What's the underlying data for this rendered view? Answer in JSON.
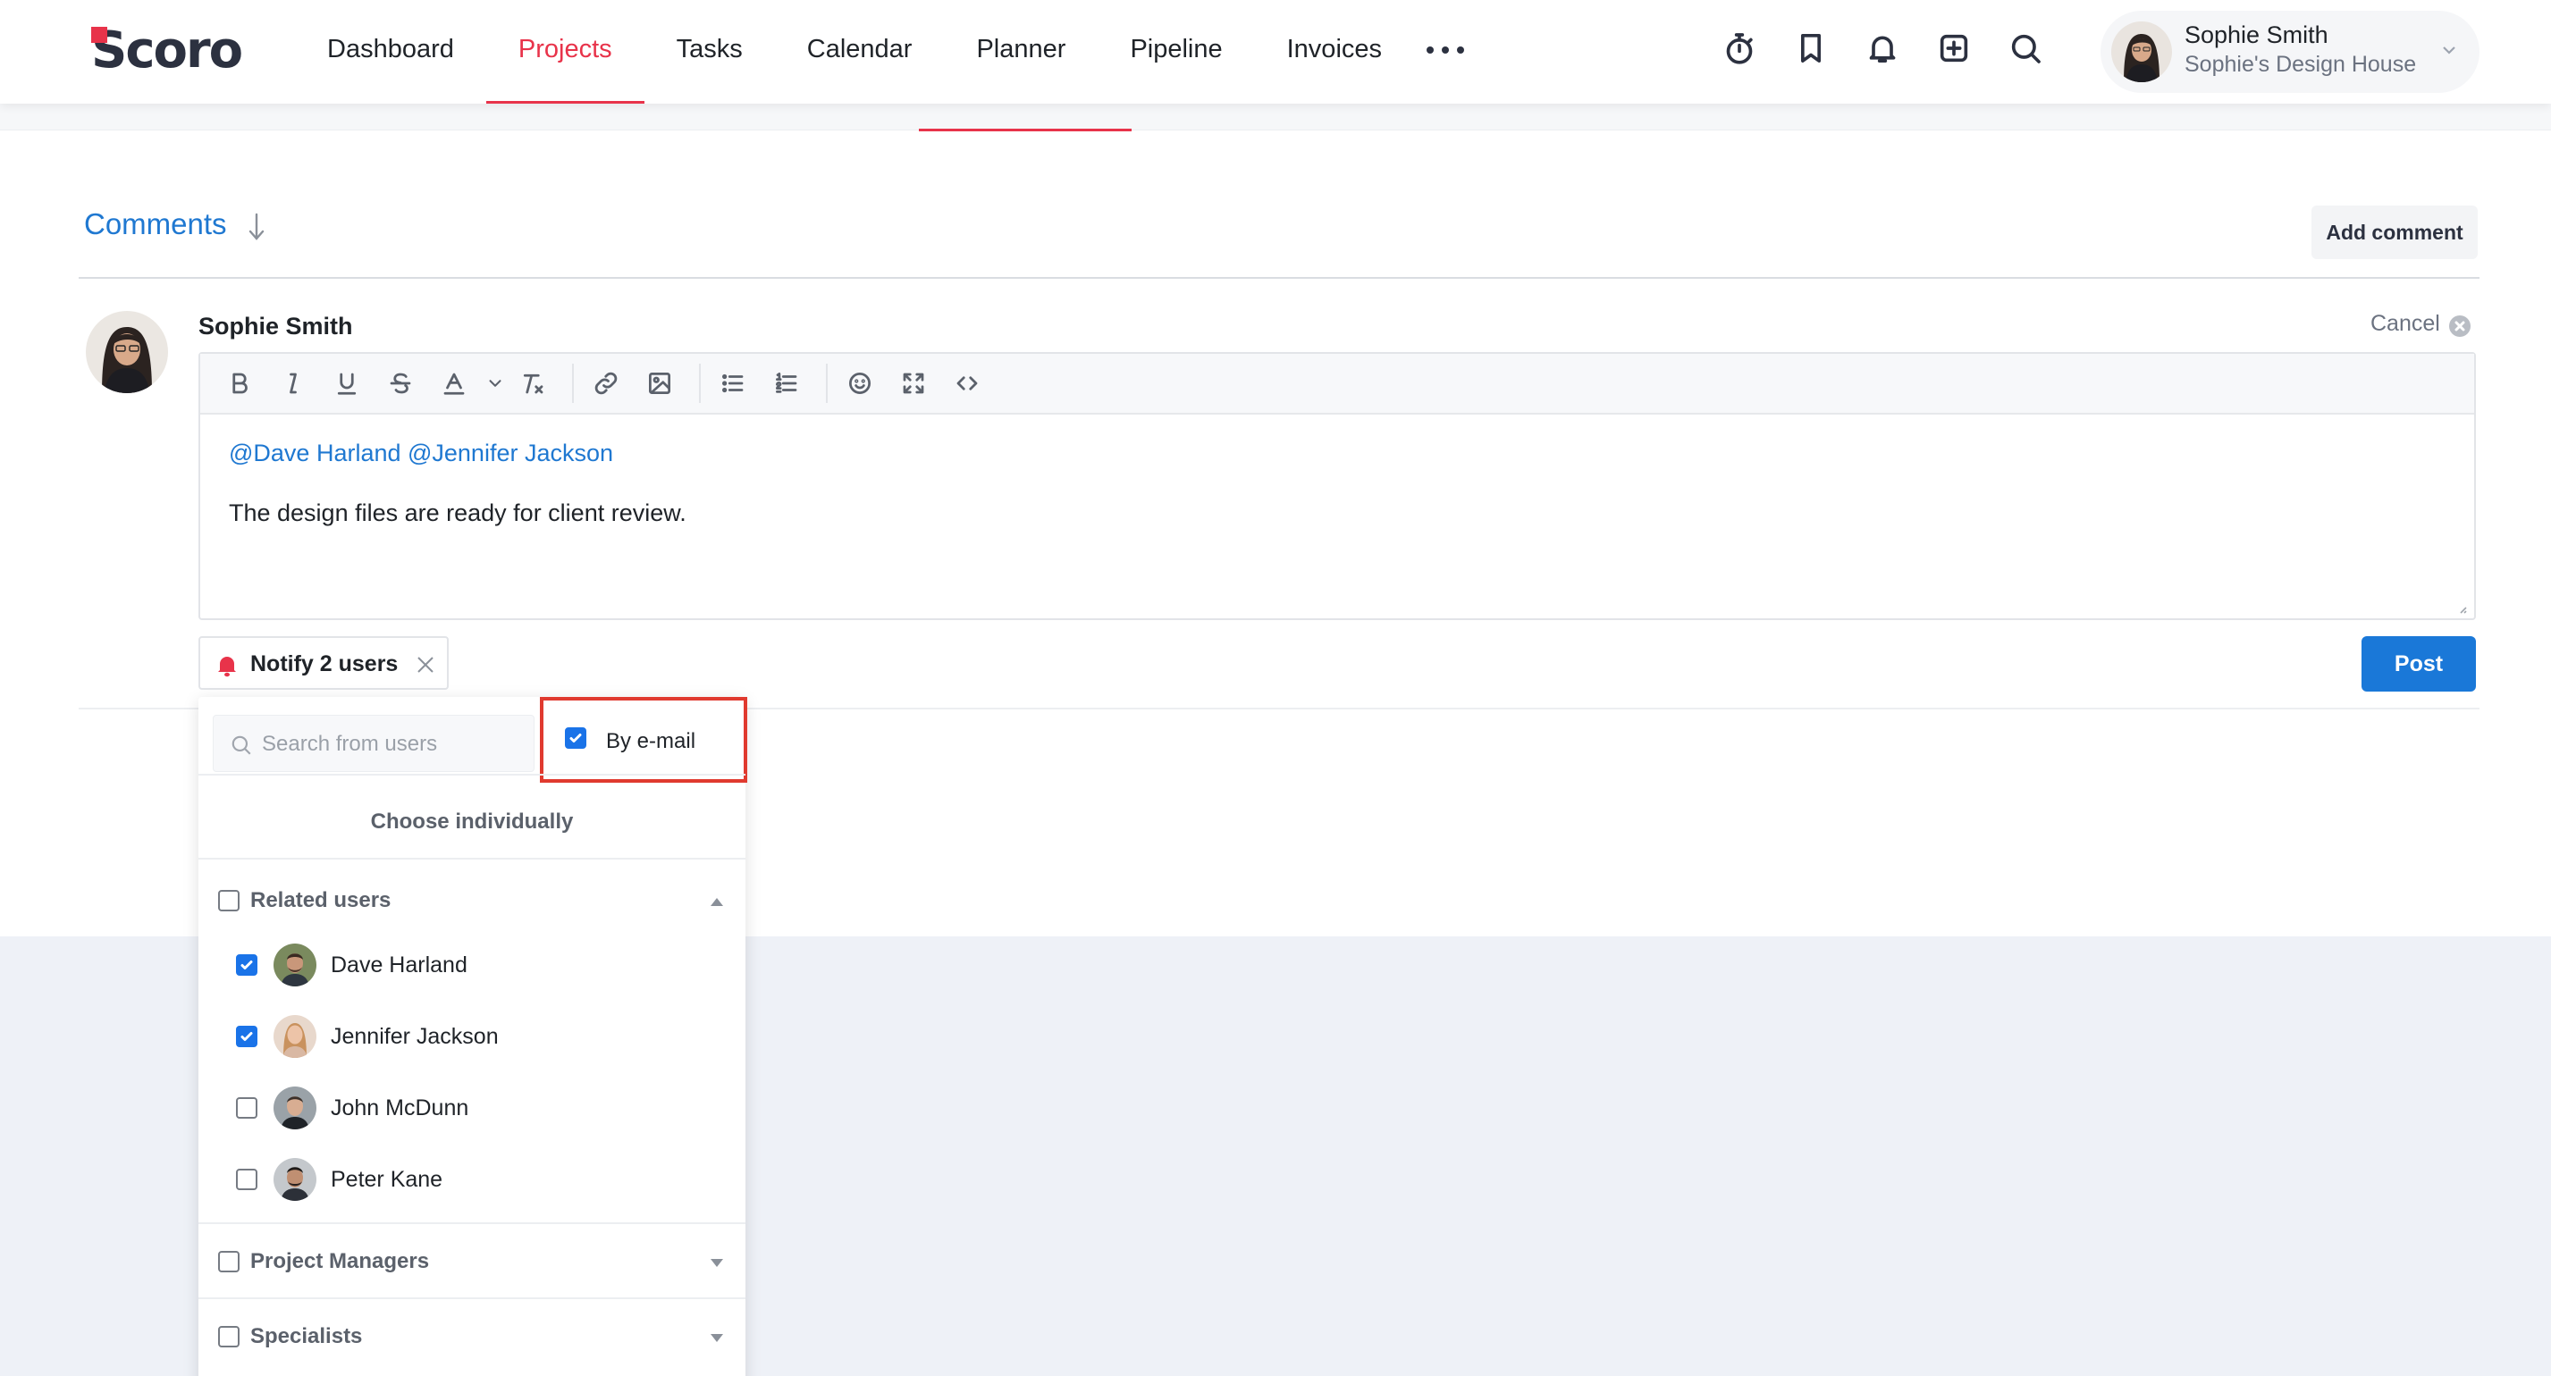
{
  "app": {
    "logo_text": "Scoro"
  },
  "nav": {
    "items": [
      {
        "label": "Dashboard",
        "active": false
      },
      {
        "label": "Projects",
        "active": true
      },
      {
        "label": "Tasks",
        "active": false
      },
      {
        "label": "Calendar",
        "active": false
      },
      {
        "label": "Planner",
        "active": false
      },
      {
        "label": "Pipeline",
        "active": false
      },
      {
        "label": "Invoices",
        "active": false
      }
    ],
    "more_icon": "more-dots-icon"
  },
  "toolbar_icons": [
    "timer-icon",
    "bookmark-icon",
    "bell-icon",
    "add-square-icon",
    "search-icon"
  ],
  "user": {
    "name": "Sophie Smith",
    "company": "Sophie's Design House"
  },
  "comments": {
    "title": "Comments",
    "add_label": "Add comment"
  },
  "editor": {
    "author": "Sophie Smith",
    "cancel_label": "Cancel",
    "mentions": "@Dave Harland @Jennifer Jackson",
    "text": "The design files are ready for client review.",
    "formatting": [
      "bold",
      "italic",
      "underline",
      "strikethrough",
      "font-color",
      "clear-format",
      "link",
      "image",
      "bullet-list",
      "numbered-list",
      "emoji",
      "fullscreen",
      "code"
    ]
  },
  "notify": {
    "label": "Notify 2 users",
    "post_label": "Post"
  },
  "dropdown": {
    "search_placeholder": "Search from users",
    "email_label": "By e-mail",
    "email_checked": true,
    "choose_label": "Choose individually",
    "groups": [
      {
        "label": "Related users",
        "expanded": true,
        "users": [
          {
            "name": "Dave Harland",
            "checked": true
          },
          {
            "name": "Jennifer Jackson",
            "checked": true
          },
          {
            "name": "John McDunn",
            "checked": false
          },
          {
            "name": "Peter Kane",
            "checked": false
          }
        ]
      },
      {
        "label": "Project Managers",
        "expanded": false
      },
      {
        "label": "Specialists",
        "expanded": false
      }
    ]
  },
  "colors": {
    "accent": "#e8334a",
    "link": "#1f78d1",
    "primary": "#1a78d8",
    "highlight": "#e03a2f"
  }
}
